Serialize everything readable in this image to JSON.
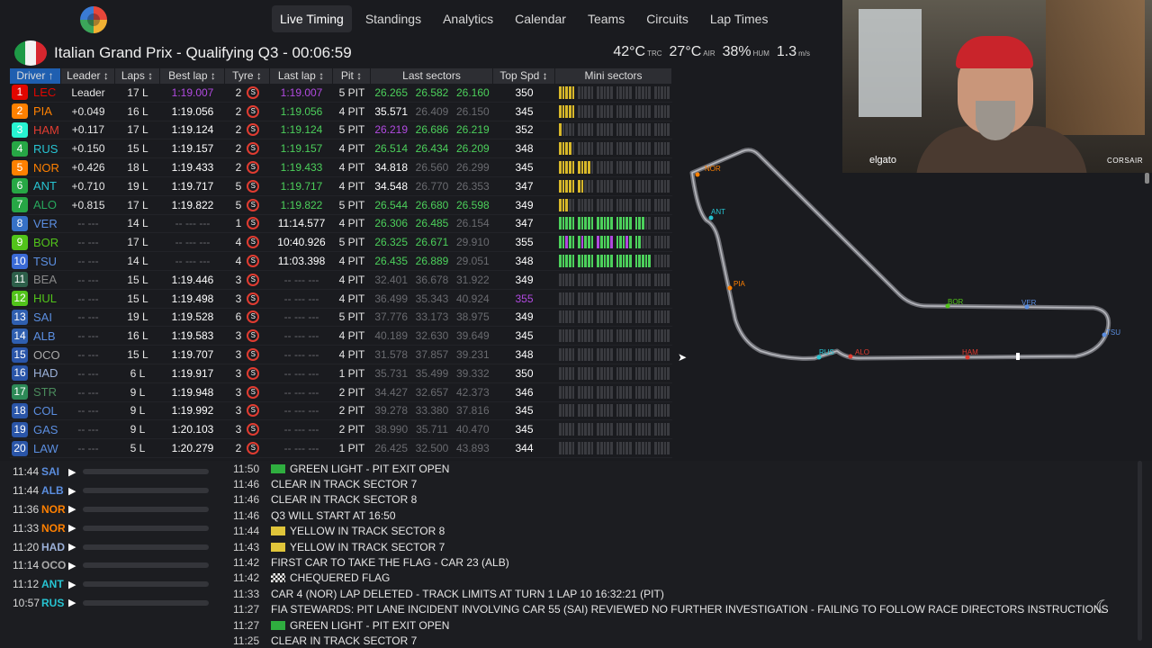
{
  "nav": {
    "items": [
      "Live Timing",
      "Standings",
      "Analytics",
      "Calendar",
      "Teams",
      "Circuits",
      "Lap Times"
    ],
    "active": "Live Timing"
  },
  "session": {
    "title": "Italian Grand Prix - Qualifying Q3 - 00:06:59",
    "track_temp": "42°C",
    "track_temp_label": "TRC",
    "air_temp": "27°C",
    "air_temp_label": "AIR",
    "humidity": "38%",
    "humidity_label": "HUM",
    "wind": "1.3",
    "wind_label": "m/s"
  },
  "table": {
    "headers": [
      "Driver ↑",
      "Leader ↕",
      "Laps ↕",
      "Best lap ↕",
      "Tyre ↕",
      "Last lap ↕",
      "Pit ↕",
      "Last sectors",
      "Top Spd ↕",
      "Mini sectors"
    ],
    "rows": [
      {
        "pos": "1",
        "team": "#e10600",
        "tla": "LEC",
        "tla_color": "#e10600",
        "leader": "Leader",
        "laps": "17 L",
        "best": "1:19.007",
        "best_cls": "purple",
        "tyre": "2",
        "last": "1:19.007",
        "last_cls": "purple",
        "pit": "5 PIT",
        "s1": "26.265",
        "s2": "26.582",
        "s3": "26.160",
        "s1c": "green",
        "s2c": "green",
        "s3c": "green",
        "spd": "350",
        "spd_cls": "white",
        "mini": [
          5,
          0,
          0,
          0,
          0,
          0
        ]
      },
      {
        "pos": "2",
        "team": "#ff8000",
        "tla": "PIA",
        "tla_color": "#ff8000",
        "leader": "+0.049",
        "laps": "16 L",
        "best": "1:19.056",
        "best_cls": "white",
        "tyre": "2",
        "last": "1:19.056",
        "last_cls": "green",
        "pit": "4 PIT",
        "s1": "35.571",
        "s2": "26.409",
        "s3": "26.150",
        "s1c": "white",
        "s2c": "dim",
        "s3c": "dim",
        "spd": "345",
        "spd_cls": "white",
        "mini": [
          5,
          0,
          0,
          0,
          0,
          0
        ]
      },
      {
        "pos": "3",
        "team": "#27f4d2",
        "tla": "HAM",
        "tla_color": "#e03c31",
        "leader": "+0.117",
        "laps": "17 L",
        "best": "1:19.124",
        "best_cls": "white",
        "tyre": "2",
        "last": "1:19.124",
        "last_cls": "green",
        "pit": "5 PIT",
        "s1": "26.219",
        "s2": "26.686",
        "s3": "26.219",
        "s1c": "purple",
        "s2c": "green",
        "s3c": "green",
        "spd": "352",
        "spd_cls": "white",
        "mini": [
          1,
          0,
          0,
          0,
          0,
          0
        ]
      },
      {
        "pos": "4",
        "team": "#27a745",
        "tla": "RUS",
        "tla_color": "#27c4d2",
        "leader": "+0.150",
        "laps": "15 L",
        "best": "1:19.157",
        "best_cls": "white",
        "tyre": "2",
        "last": "1:19.157",
        "last_cls": "green",
        "pit": "4 PIT",
        "s1": "26.514",
        "s2": "26.434",
        "s3": "26.209",
        "s1c": "green",
        "s2c": "green",
        "s3c": "green",
        "spd": "348",
        "spd_cls": "white",
        "mini": [
          4,
          0,
          0,
          0,
          0,
          0
        ]
      },
      {
        "pos": "5",
        "team": "#ff8000",
        "tla": "NOR",
        "tla_color": "#ff8000",
        "leader": "+0.426",
        "laps": "18 L",
        "best": "1:19.433",
        "best_cls": "white",
        "tyre": "2",
        "last": "1:19.433",
        "last_cls": "green",
        "pit": "4 PIT",
        "s1": "34.818",
        "s2": "26.560",
        "s3": "26.299",
        "s1c": "white",
        "s2c": "dim",
        "s3c": "dim",
        "spd": "345",
        "spd_cls": "white",
        "mini": [
          5,
          4,
          0,
          0,
          0,
          0
        ]
      },
      {
        "pos": "6",
        "team": "#27a745",
        "tla": "ANT",
        "tla_color": "#27c4d2",
        "leader": "+0.710",
        "laps": "19 L",
        "best": "1:19.717",
        "best_cls": "white",
        "tyre": "5",
        "last": "1:19.717",
        "last_cls": "green",
        "pit": "4 PIT",
        "s1": "34.548",
        "s2": "26.770",
        "s3": "26.353",
        "s1c": "white",
        "s2c": "dim",
        "s3c": "dim",
        "spd": "347",
        "spd_cls": "white",
        "mini": [
          5,
          2,
          0,
          0,
          0,
          0
        ]
      },
      {
        "pos": "7",
        "team": "#27a745",
        "tla": "ALO",
        "tla_color": "#27a75c",
        "leader": "+0.815",
        "laps": "17 L",
        "best": "1:19.822",
        "best_cls": "white",
        "tyre": "5",
        "last": "1:19.822",
        "last_cls": "green",
        "pit": "5 PIT",
        "s1": "26.544",
        "s2": "26.680",
        "s3": "26.598",
        "s1c": "green",
        "s2c": "green",
        "s3c": "green",
        "spd": "349",
        "spd_cls": "white",
        "mini": [
          3,
          0,
          0,
          0,
          0,
          0
        ]
      },
      {
        "pos": "8",
        "team": "#3671c6",
        "tla": "VER",
        "tla_color": "#5b8ee0",
        "leader": "-- ---",
        "laps": "14 L",
        "best": "-- --- ---",
        "best_cls": "dim",
        "tyre": "1",
        "last": "11:14.577",
        "last_cls": "white",
        "pit": "4 PIT",
        "s1": "26.306",
        "s2": "26.485",
        "s3": "26.154",
        "s1c": "green",
        "s2c": "green",
        "s3c": "dim",
        "spd": "347",
        "spd_cls": "white",
        "mini": [
          5,
          5,
          5,
          5,
          3,
          0
        ]
      },
      {
        "pos": "9",
        "team": "#52c41a",
        "tla": "BOR",
        "tla_color": "#52c41a",
        "leader": "-- ---",
        "laps": "17 L",
        "best": "-- --- ---",
        "best_cls": "dim",
        "tyre": "4",
        "last": "10:40.926",
        "last_cls": "white",
        "pit": "5 PIT",
        "s1": "26.325",
        "s2": "26.671",
        "s3": "29.910",
        "s1c": "green",
        "s2c": "green",
        "s3c": "dim",
        "spd": "355",
        "spd_cls": "white",
        "mini": [
          5,
          5,
          5,
          5,
          2,
          0
        ]
      },
      {
        "pos": "10",
        "team": "#3a6ad6",
        "tla": "TSU",
        "tla_color": "#5b8ee0",
        "leader": "-- ---",
        "laps": "14 L",
        "best": "-- --- ---",
        "best_cls": "dim",
        "tyre": "4",
        "last": "11:03.398",
        "last_cls": "white",
        "pit": "4 PIT",
        "s1": "26.435",
        "s2": "26.889",
        "s3": "29.051",
        "s1c": "green",
        "s2c": "green",
        "s3c": "dim",
        "spd": "348",
        "spd_cls": "white",
        "mini": [
          5,
          5,
          5,
          5,
          5,
          0
        ]
      },
      {
        "pos": "11",
        "team": "#2d5f4a",
        "tla": "BEA",
        "tla_color": "#888888",
        "leader": "-- ---",
        "laps": "15 L",
        "best": "1:19.446",
        "best_cls": "white",
        "tyre": "3",
        "last": "-- --- ---",
        "last_cls": "dim",
        "pit": "4 PIT",
        "s1": "32.401",
        "s2": "36.678",
        "s3": "31.922",
        "s1c": "dim",
        "s2c": "dim",
        "s3c": "dim",
        "spd": "349",
        "spd_cls": "white",
        "mini": [
          0,
          0,
          0,
          0,
          0,
          0
        ]
      },
      {
        "pos": "12",
        "team": "#52c41a",
        "tla": "HUL",
        "tla_color": "#52c41a",
        "leader": "-- ---",
        "laps": "15 L",
        "best": "1:19.498",
        "best_cls": "white",
        "tyre": "3",
        "last": "-- --- ---",
        "last_cls": "dim",
        "pit": "4 PIT",
        "s1": "36.499",
        "s2": "35.343",
        "s3": "40.924",
        "s1c": "dim",
        "s2c": "dim",
        "s3c": "dim",
        "spd": "355",
        "spd_cls": "purple",
        "mini": [
          0,
          0,
          0,
          0,
          0,
          0
        ]
      },
      {
        "pos": "13",
        "team": "#2f5fb0",
        "tla": "SAI",
        "tla_color": "#5b8ee0",
        "leader": "-- ---",
        "laps": "19 L",
        "best": "1:19.528",
        "best_cls": "white",
        "tyre": "6",
        "last": "-- --- ---",
        "last_cls": "dim",
        "pit": "5 PIT",
        "s1": "37.776",
        "s2": "33.173",
        "s3": "38.975",
        "s1c": "dim",
        "s2c": "dim",
        "s3c": "dim",
        "spd": "349",
        "spd_cls": "white",
        "mini": [
          0,
          0,
          0,
          0,
          0,
          0
        ]
      },
      {
        "pos": "14",
        "team": "#2f5fb0",
        "tla": "ALB",
        "tla_color": "#5b8ee0",
        "leader": "-- ---",
        "laps": "16 L",
        "best": "1:19.583",
        "best_cls": "white",
        "tyre": "3",
        "last": "-- --- ---",
        "last_cls": "dim",
        "pit": "4 PIT",
        "s1": "40.189",
        "s2": "32.630",
        "s3": "39.649",
        "s1c": "dim",
        "s2c": "dim",
        "s3c": "dim",
        "spd": "345",
        "spd_cls": "white",
        "mini": [
          0,
          0,
          0,
          0,
          0,
          0
        ]
      },
      {
        "pos": "15",
        "team": "#2a55a8",
        "tla": "OCO",
        "tla_color": "#aaaaaa",
        "leader": "-- ---",
        "laps": "15 L",
        "best": "1:19.707",
        "best_cls": "white",
        "tyre": "3",
        "last": "-- --- ---",
        "last_cls": "dim",
        "pit": "4 PIT",
        "s1": "31.578",
        "s2": "37.857",
        "s3": "39.231",
        "s1c": "dim",
        "s2c": "dim",
        "s3c": "dim",
        "spd": "348",
        "spd_cls": "white",
        "mini": [
          0,
          0,
          0,
          0,
          0,
          0
        ]
      },
      {
        "pos": "16",
        "team": "#2a55a8",
        "tla": "HAD",
        "tla_color": "#9bb0d8",
        "leader": "-- ---",
        "laps": "6 L",
        "best": "1:19.917",
        "best_cls": "white",
        "tyre": "3",
        "last": "-- --- ---",
        "last_cls": "dim",
        "pit": "1 PIT",
        "s1": "35.731",
        "s2": "35.499",
        "s3": "39.332",
        "s1c": "dim",
        "s2c": "dim",
        "s3c": "dim",
        "spd": "350",
        "spd_cls": "white",
        "mini": [
          0,
          0,
          0,
          0,
          0,
          0
        ]
      },
      {
        "pos": "17",
        "team": "#2d8a57",
        "tla": "STR",
        "tla_color": "#4a8a5c",
        "leader": "-- ---",
        "laps": "9 L",
        "best": "1:19.948",
        "best_cls": "white",
        "tyre": "3",
        "last": "-- --- ---",
        "last_cls": "dim",
        "pit": "2 PIT",
        "s1": "34.427",
        "s2": "32.657",
        "s3": "42.373",
        "s1c": "dim",
        "s2c": "dim",
        "s3c": "dim",
        "spd": "346",
        "spd_cls": "white",
        "mini": [
          0,
          0,
          0,
          0,
          0,
          0
        ]
      },
      {
        "pos": "18",
        "team": "#2a55a8",
        "tla": "COL",
        "tla_color": "#5b8ee0",
        "leader": "-- ---",
        "laps": "9 L",
        "best": "1:19.992",
        "best_cls": "white",
        "tyre": "3",
        "last": "-- --- ---",
        "last_cls": "dim",
        "pit": "2 PIT",
        "s1": "39.278",
        "s2": "33.380",
        "s3": "37.816",
        "s1c": "dim",
        "s2c": "dim",
        "s3c": "dim",
        "spd": "345",
        "spd_cls": "white",
        "mini": [
          0,
          0,
          0,
          0,
          0,
          0
        ]
      },
      {
        "pos": "19",
        "team": "#2a55a8",
        "tla": "GAS",
        "tla_color": "#5b8ee0",
        "leader": "-- ---",
        "laps": "9 L",
        "best": "1:20.103",
        "best_cls": "white",
        "tyre": "3",
        "last": "-- --- ---",
        "last_cls": "dim",
        "pit": "2 PIT",
        "s1": "38.990",
        "s2": "35.711",
        "s3": "40.470",
        "s1c": "dim",
        "s2c": "dim",
        "s3c": "dim",
        "spd": "345",
        "spd_cls": "white",
        "mini": [
          0,
          0,
          0,
          0,
          0,
          0
        ]
      },
      {
        "pos": "20",
        "team": "#2a55a8",
        "tla": "LAW",
        "tla_color": "#5b8ee0",
        "leader": "-- ---",
        "laps": "5 L",
        "best": "1:20.279",
        "best_cls": "white",
        "tyre": "2",
        "last": "-- --- ---",
        "last_cls": "dim",
        "pit": "1 PIT",
        "s1": "26.425",
        "s2": "32.500",
        "s3": "43.893",
        "s1c": "dim",
        "s2c": "dim",
        "s3c": "dim",
        "spd": "344",
        "spd_cls": "white",
        "mini": [
          0,
          0,
          0,
          0,
          0,
          0
        ]
      }
    ]
  },
  "map": {
    "labels": [
      "NOR",
      "ANT",
      "PIA",
      "BOR",
      "VER",
      "TSU",
      "RUS",
      "ALO",
      "HAM"
    ]
  },
  "webcam": {
    "brand_left": "elgato",
    "brand_right": "CORSAIR"
  },
  "team_radio": [
    {
      "time": "11:44",
      "tla": "SAI",
      "color": "#5b8ee0"
    },
    {
      "time": "11:44",
      "tla": "ALB",
      "color": "#5b8ee0"
    },
    {
      "time": "11:36",
      "tla": "NOR",
      "color": "#ff8000"
    },
    {
      "time": "11:33",
      "tla": "NOR",
      "color": "#ff8000"
    },
    {
      "time": "11:20",
      "tla": "HAD",
      "color": "#9bb0d8"
    },
    {
      "time": "11:14",
      "tla": "OCO",
      "color": "#aaaaaa"
    },
    {
      "time": "11:12",
      "tla": "ANT",
      "color": "#27c4d2"
    },
    {
      "time": "10:57",
      "tla": "RUS",
      "color": "#27c4d2"
    }
  ],
  "race_control": [
    {
      "time": "11:50",
      "flag": "green",
      "text": "GREEN LIGHT - PIT EXIT OPEN"
    },
    {
      "time": "11:46",
      "flag": "",
      "text": "CLEAR IN TRACK SECTOR 7"
    },
    {
      "time": "11:46",
      "flag": "",
      "text": "CLEAR IN TRACK SECTOR 8"
    },
    {
      "time": "11:46",
      "flag": "",
      "text": "Q3 WILL START AT 16:50"
    },
    {
      "time": "11:44",
      "flag": "yellow",
      "text": "YELLOW IN TRACK SECTOR 8"
    },
    {
      "time": "11:43",
      "flag": "yellow",
      "text": "YELLOW IN TRACK SECTOR 7"
    },
    {
      "time": "11:42",
      "flag": "",
      "text": "FIRST CAR TO TAKE THE FLAG - CAR 23 (ALB)"
    },
    {
      "time": "11:42",
      "flag": "chequered",
      "text": "CHEQUERED FLAG"
    },
    {
      "time": "11:33",
      "flag": "",
      "text": "CAR 4 (NOR) LAP DELETED - TRACK LIMITS AT TURN 1 LAP 10 16:32:21 (PIT)"
    },
    {
      "time": "11:27",
      "flag": "",
      "text": "FIA STEWARDS: PIT LANE INCIDENT INVOLVING CAR 55 (SAI) REVIEWED NO FURTHER INVESTIGATION - FAILING TO FOLLOW RACE DIRECTORS INSTRUCTIONS"
    },
    {
      "time": "11:27",
      "flag": "green",
      "text": "GREEN LIGHT - PIT EXIT OPEN"
    },
    {
      "time": "11:25",
      "flag": "",
      "text": "CLEAR IN TRACK SECTOR 7"
    }
  ]
}
